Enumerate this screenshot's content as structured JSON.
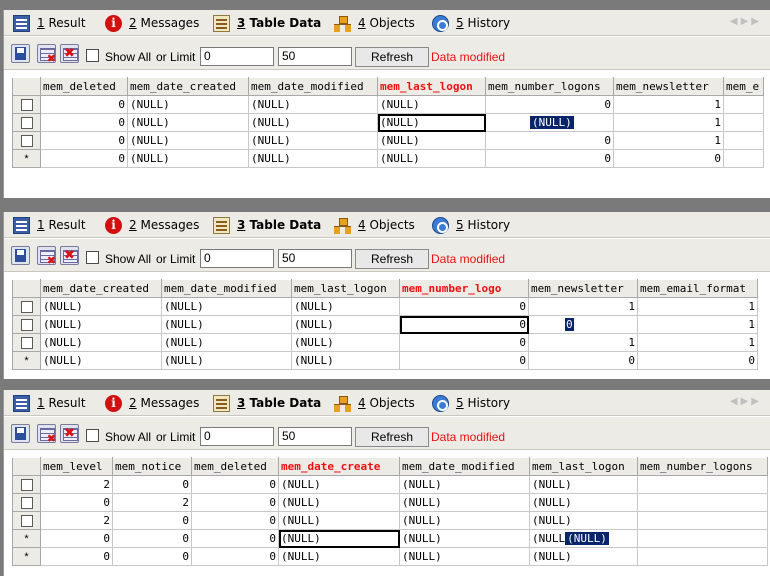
{
  "tabs": [
    {
      "num": "1",
      "label": "Result"
    },
    {
      "num": "2",
      "label": "Messages"
    },
    {
      "num": "3",
      "label": "Table Data"
    },
    {
      "num": "4",
      "label": "Objects"
    },
    {
      "num": "5",
      "label": "History"
    }
  ],
  "toolbar": {
    "show_all": "Show All",
    "or_limit": "or Limit",
    "limit_from": "0",
    "limit_count": "50",
    "refresh": "Refresh",
    "status": "Data modified"
  },
  "pane1": {
    "columns": [
      "mem_deleted",
      "mem_date_created",
      "mem_date_modified",
      "mem_last_logon",
      "mem_number_logons",
      "mem_newsletter",
      "mem_e"
    ],
    "rows": [
      {
        "marker": "check",
        "cells": [
          "0",
          "(NULL)",
          "(NULL)",
          "(NULL)",
          "0",
          "1",
          ""
        ]
      },
      {
        "marker": "check",
        "cells": [
          "0",
          "(NULL)",
          "(NULL)",
          "(NULL)",
          "(NULL)",
          "1",
          ""
        ]
      },
      {
        "marker": "check",
        "cells": [
          "0",
          "(NULL)",
          "(NULL)",
          "(NULL)",
          "0",
          "1",
          ""
        ]
      },
      {
        "marker": "*",
        "cells": [
          "0",
          "(NULL)",
          "(NULL)",
          "(NULL)",
          "0",
          "0",
          ""
        ]
      }
    ]
  },
  "pane2": {
    "columns": [
      "mem_date_created",
      "mem_date_modified",
      "mem_last_logon",
      "mem_number_logo",
      "mem_newsletter",
      "mem_email_format"
    ],
    "rows": [
      {
        "marker": "check",
        "cells": [
          "(NULL)",
          "(NULL)",
          "(NULL)",
          "0",
          "1",
          "1"
        ]
      },
      {
        "marker": "check",
        "cells": [
          "(NULL)",
          "(NULL)",
          "(NULL)",
          "0",
          "0",
          "1"
        ]
      },
      {
        "marker": "check",
        "cells": [
          "(NULL)",
          "(NULL)",
          "(NULL)",
          "0",
          "1",
          "1"
        ]
      },
      {
        "marker": "*",
        "cells": [
          "(NULL)",
          "(NULL)",
          "(NULL)",
          "0",
          "0",
          "0"
        ]
      }
    ]
  },
  "pane3": {
    "columns": [
      "mem_level",
      "mem_notice",
      "mem_deleted",
      "mem_date_create",
      "mem_date_modified",
      "mem_last_logon",
      "mem_number_logons"
    ],
    "rows": [
      {
        "marker": "check",
        "cells": [
          "2",
          "0",
          "0",
          "(NULL)",
          "(NULL)",
          "(NULL)",
          ""
        ]
      },
      {
        "marker": "check",
        "cells": [
          "0",
          "2",
          "0",
          "(NULL)",
          "(NULL)",
          "(NULL)",
          ""
        ]
      },
      {
        "marker": "check",
        "cells": [
          "2",
          "0",
          "0",
          "(NULL)",
          "(NULL)",
          "(NULL)",
          ""
        ]
      },
      {
        "marker": "*",
        "cells": [
          "0",
          "0",
          "0",
          "(NULL)",
          "(NULL)",
          "(NULL",
          ""
        ],
        "edit_text": "(NULL)"
      },
      {
        "marker": "*",
        "cells": [
          "0",
          "0",
          "0",
          "(NULL)",
          "(NULL)",
          "(NULL)",
          ""
        ]
      }
    ]
  }
}
